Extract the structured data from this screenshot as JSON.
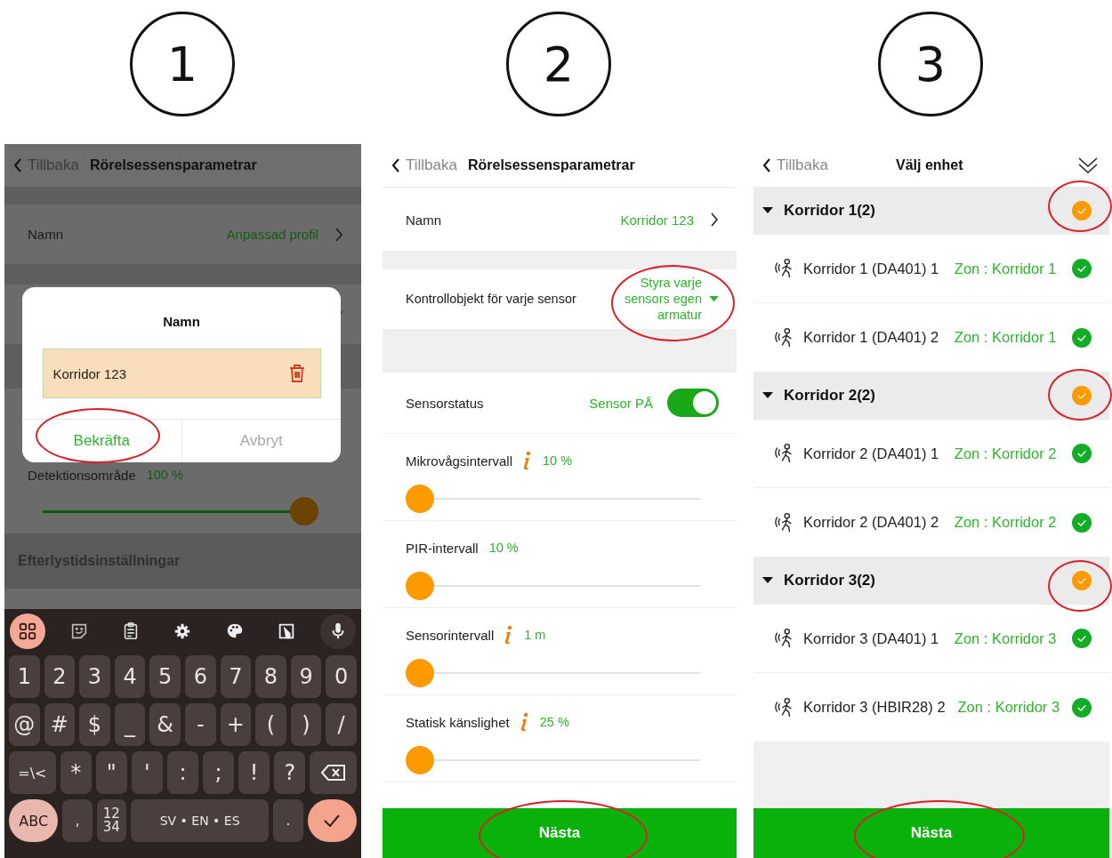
{
  "step_badges": [
    "1",
    "2",
    "3"
  ],
  "screen_1": {
    "header": {
      "back": "Tillbaka",
      "title": "Rörelsessensparametrar"
    },
    "name_row": {
      "label": "Namn",
      "value": "Anpassad profil"
    },
    "detection": {
      "label": "Detektionsområde",
      "reading": "100 %",
      "level": 1
    },
    "section_title": "Efterlystidsinställningar",
    "dialog": {
      "title": "Namn",
      "value": "Korridor 123",
      "buttons": [
        {
          "label": "Bekräfta",
          "kind": "confirm"
        },
        {
          "label": "Avbryt",
          "kind": "cancel"
        }
      ]
    },
    "keyboard": {
      "toolbar": [
        {
          "kind": "apps",
          "selected": true
        },
        {
          "kind": "sticker",
          "selected": false
        },
        {
          "kind": "clipboard",
          "selected": false
        },
        {
          "kind": "settings",
          "selected": false
        },
        {
          "kind": "palette",
          "selected": false
        },
        {
          "kind": "crop",
          "selected": false
        },
        {
          "kind": "mic",
          "selected": false
        }
      ],
      "number_row": [
        {
          "label": "1",
          "kind": "char"
        },
        {
          "label": "2",
          "kind": "char"
        },
        {
          "label": "3",
          "kind": "char"
        },
        {
          "label": "4",
          "kind": "char"
        },
        {
          "label": "5",
          "kind": "char"
        },
        {
          "label": "6",
          "kind": "char"
        },
        {
          "label": "7",
          "kind": "char"
        },
        {
          "label": "8",
          "kind": "char"
        },
        {
          "label": "9",
          "kind": "char"
        },
        {
          "label": "0",
          "kind": "char"
        }
      ],
      "symbol_row": [
        {
          "label": "@",
          "kind": "char"
        },
        {
          "label": "#",
          "kind": "char"
        },
        {
          "label": "$",
          "kind": "char"
        },
        {
          "label": "_",
          "kind": "char"
        },
        {
          "label": "&",
          "kind": "char"
        },
        {
          "label": "-",
          "kind": "char"
        },
        {
          "label": "+",
          "kind": "char"
        },
        {
          "label": "(",
          "kind": "char"
        },
        {
          "label": ")",
          "kind": "char"
        },
        {
          "label": "/",
          "kind": "char"
        }
      ],
      "punctuation_row": [
        {
          "label": "=\\<",
          "kind": "wide"
        },
        {
          "label": "*",
          "kind": "char"
        },
        {
          "label": "\"",
          "kind": "char"
        },
        {
          "label": "'",
          "kind": "char"
        },
        {
          "label": ":",
          "kind": "char"
        },
        {
          "label": ";",
          "kind": "char"
        },
        {
          "label": "!",
          "kind": "char"
        },
        {
          "label": "?",
          "kind": "char"
        },
        {
          "kind": "backspace"
        }
      ],
      "bottom_row": [
        {
          "label": "ABC",
          "kind": "abc"
        },
        {
          "label": ",",
          "kind": "small"
        },
        {
          "label": "12\n34",
          "kind": "small"
        },
        {
          "label": "SV • EN • ES",
          "kind": "space"
        },
        {
          "label": ".",
          "kind": "small"
        },
        {
          "kind": "enter"
        }
      ]
    }
  },
  "screen_2": {
    "header": {
      "back": "Tillbaka",
      "title": "Rörelsessensparametrar"
    },
    "rows": [
      {
        "kind": "nav",
        "label": "Namn",
        "value": "Korridor 123"
      },
      {
        "kind": "dropdown",
        "label": "Kontrollobjekt för varje sensor",
        "value": "Styra varje sensors egen armatur"
      },
      {
        "kind": "toggle",
        "label": "Sensorstatus",
        "value": "Sensor PÅ",
        "on": true
      },
      {
        "kind": "slider",
        "label": "Mikrovågsintervall",
        "info": true,
        "reading": "10 %",
        "level": 0
      },
      {
        "kind": "slider",
        "label": "PIR-intervall",
        "info": false,
        "reading": "10 %",
        "level": 0
      },
      {
        "kind": "slider",
        "label": "Sensorintervall",
        "info": true,
        "reading": "1 m",
        "level": 0
      },
      {
        "kind": "slider",
        "label": "Statisk känslighet",
        "info": true,
        "reading": "25 %",
        "level": 0
      }
    ],
    "button": "Nästa"
  },
  "screen_3": {
    "header": {
      "back": "Tillbaka",
      "title": "Välj enhet"
    },
    "groups": [
      {
        "name": "Korridor 1(2)",
        "expanded": true,
        "checked": true,
        "devices": [
          {
            "name": "Korridor 1 (DA401) 1",
            "zone": "Zon : Korridor 1",
            "checked": true
          },
          {
            "name": "Korridor 1 (DA401) 2",
            "zone": "Zon : Korridor 1",
            "checked": true
          }
        ]
      },
      {
        "name": "Korridor 2(2)",
        "expanded": true,
        "checked": true,
        "devices": [
          {
            "name": "Korridor 2 (DA401) 1",
            "zone": "Zon : Korridor 2",
            "checked": true
          },
          {
            "name": "Korridor 2 (DA401) 2",
            "zone": "Zon : Korridor 2",
            "checked": true
          }
        ]
      },
      {
        "name": "Korridor 3(2)",
        "expanded": true,
        "checked": true,
        "devices": [
          {
            "name": "Korridor 3 (DA401) 1",
            "zone": "Zon : Korridor 3",
            "checked": true
          },
          {
            "name": "Korridor 3 (HBIR28) 2",
            "zone": "Zon : Korridor 3",
            "checked": true
          }
        ]
      }
    ],
    "button": "Nästa"
  }
}
